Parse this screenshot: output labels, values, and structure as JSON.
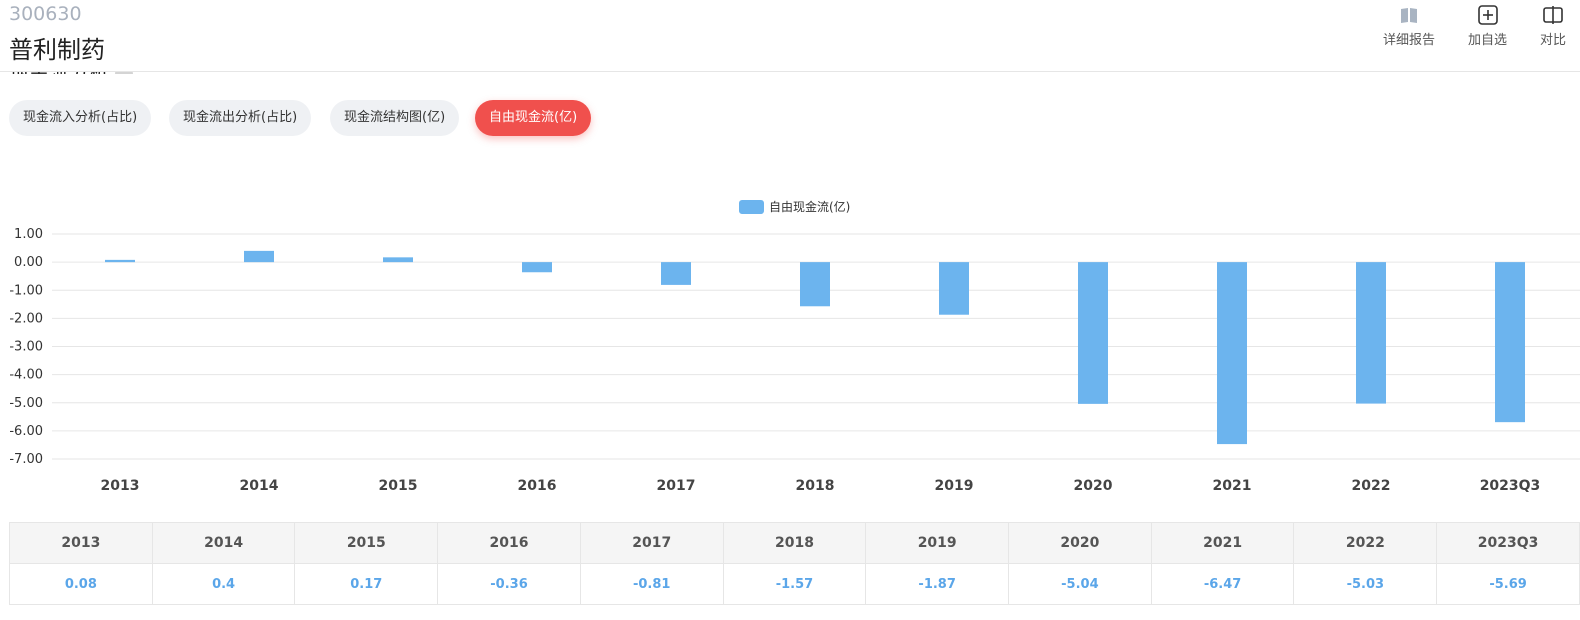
{
  "header": {
    "stock_code": "300630",
    "stock_name": "普利制药",
    "actions": [
      {
        "label": "详细报告",
        "icon": "book-icon"
      },
      {
        "label": "加自选",
        "icon": "plus-square-icon"
      },
      {
        "label": "对比",
        "icon": "compare-icon"
      }
    ]
  },
  "section": {
    "title": "现金流分析"
  },
  "tabs": [
    {
      "label": "现金流入分析(占比)",
      "active": false
    },
    {
      "label": "现金流出分析(占比)",
      "active": false
    },
    {
      "label": "现金流结构图(亿)",
      "active": false
    },
    {
      "label": "自由现金流(亿)",
      "active": true
    }
  ],
  "colors": {
    "bar": "#6cb4ee",
    "active_tab": "#f0504d",
    "value_text": "#5ba6e9"
  },
  "chart_data": {
    "type": "bar",
    "legend": "自由现金流(亿)",
    "categories": [
      "2013",
      "2014",
      "2015",
      "2016",
      "2017",
      "2018",
      "2019",
      "2020",
      "2021",
      "2022",
      "2023Q3"
    ],
    "series": [
      {
        "name": "自由现金流(亿)",
        "values": [
          0.08,
          0.4,
          0.17,
          -0.36,
          -0.81,
          -1.57,
          -1.87,
          -5.04,
          -6.47,
          -5.03,
          -5.69
        ]
      }
    ],
    "yticks": [
      "1.00",
      "0.00",
      "-1.00",
      "-2.00",
      "-3.00",
      "-4.00",
      "-5.00",
      "-6.00",
      "-7.00"
    ],
    "ylim": [
      -7,
      1
    ],
    "grid": true,
    "legend_position": "top-center"
  },
  "table": {
    "headers": [
      "2013",
      "2014",
      "2015",
      "2016",
      "2017",
      "2018",
      "2019",
      "2020",
      "2021",
      "2022",
      "2023Q3"
    ],
    "values": [
      "0.08",
      "0.4",
      "0.17",
      "-0.36",
      "-0.81",
      "-1.57",
      "-1.87",
      "-5.04",
      "-6.47",
      "-5.03",
      "-5.69"
    ]
  }
}
